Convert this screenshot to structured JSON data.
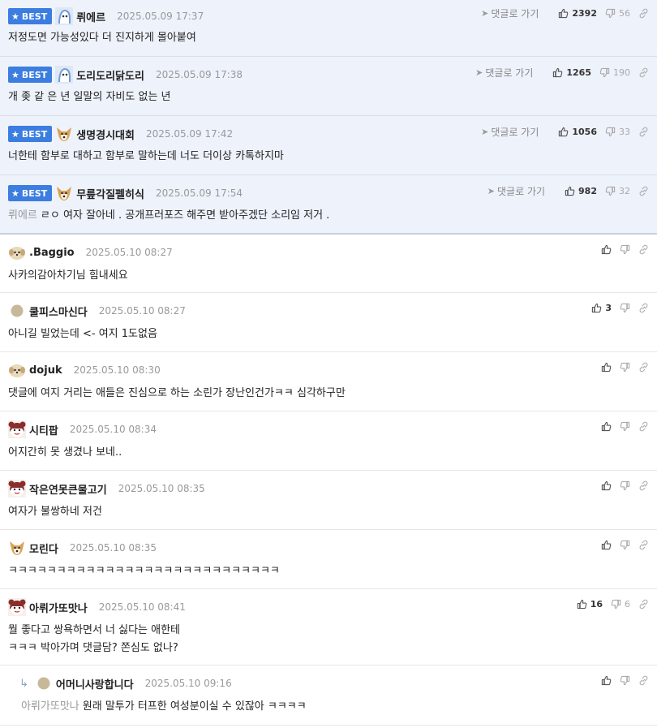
{
  "labels": {
    "best": "BEST",
    "goto": "댓글로 가기"
  },
  "best_comments": [
    {
      "nick": "뤼에르",
      "date": "2025.05.09 17:37",
      "text": "저정도면 가능성있다 더 진지하게 몰아붙여",
      "ref": "",
      "likes": "2392",
      "dislikes": "56",
      "avatar": "ghost"
    },
    {
      "nick": "도리도리닭도리",
      "date": "2025.05.09 17:38",
      "text": "개 좆 같 은 년 일말의 자비도 없는 년",
      "ref": "",
      "likes": "1265",
      "dislikes": "190",
      "avatar": "ghost"
    },
    {
      "nick": "생명경시대회",
      "date": "2025.05.09 17:42",
      "text": "너한테 함부로 대하고 함부로 말하는데 너도 더이상 카톡하지마",
      "ref": "",
      "likes": "1056",
      "dislikes": "33",
      "avatar": "dog"
    },
    {
      "nick": "무릎각질펠히식",
      "date": "2025.05.09 17:54",
      "text": "ㄹㅇ 여자 잘아네 . 공개프러포즈 해주면 받아주겠단 소리임 저거 .",
      "ref": "뤼에르",
      "likes": "982",
      "dislikes": "32",
      "avatar": "dog"
    }
  ],
  "comments": [
    {
      "nick": ".Baggio",
      "date": "2025.05.10 08:27",
      "lines": [
        "사카의감아차기님 힘내세요"
      ],
      "ref": "",
      "likes": "",
      "dislikes": "",
      "avatar": "puppy"
    },
    {
      "nick": "쿨피스마신다",
      "date": "2025.05.10 08:27",
      "lines": [
        "아니길 빌었는데 <- 여지 1도없음"
      ],
      "ref": "",
      "likes": "3",
      "dislikes": "",
      "avatar": "dot"
    },
    {
      "nick": "dojuk",
      "date": "2025.05.10 08:30",
      "lines": [
        "댓글에 여지 거리는 애들은 진심으로 하는 소린가 장난인건가ㅋㅋ 심각하구만"
      ],
      "ref": "",
      "likes": "",
      "dislikes": "",
      "avatar": "puppy"
    },
    {
      "nick": "시티팝",
      "date": "2025.05.10 08:34",
      "lines": [
        "어지간히 못 생겼나 보네.."
      ],
      "ref": "",
      "likes": "",
      "dislikes": "",
      "avatar": "bear"
    },
    {
      "nick": "작은연못큰물고기",
      "date": "2025.05.10 08:35",
      "lines": [
        "여자가 불쌍하네 저건"
      ],
      "ref": "",
      "likes": "",
      "dislikes": "",
      "avatar": "bear"
    },
    {
      "nick": "모린다",
      "date": "2025.05.10 08:35",
      "lines": [
        "ㅋㅋㅋㅋㅋㅋㅋㅋㅋㅋㅋㅋㅋㅋㅋㅋㅋㅋㅋㅋㅋㅋㅋㅋㅋㅋㅋㅋ"
      ],
      "ref": "",
      "likes": "",
      "dislikes": "",
      "avatar": "dog"
    },
    {
      "nick": "아뤼가또맛나",
      "date": "2025.05.10 08:41",
      "lines": [
        "뭘 좋다고 쌍욕하면서 너 싫다는 애한테",
        "ㅋㅋㅋ 박아가며 댓글담? 쫀심도 없나?"
      ],
      "ref": "",
      "likes": "16",
      "dislikes": "6",
      "avatar": "bear"
    },
    {
      "nick": "어머니사랑합니다",
      "date": "2025.05.10 09:16",
      "lines": [
        "원래 말투가 터프한 여성분이실 수 있잖아 ㅋㅋㅋㅋ"
      ],
      "ref": "아뤼가또맛나",
      "likes": "",
      "dislikes": "",
      "avatar": "dot",
      "reply": true
    }
  ],
  "colors": {
    "best_bg": "#eef2fb",
    "badge": "#3b7de0",
    "date": "#999999"
  }
}
